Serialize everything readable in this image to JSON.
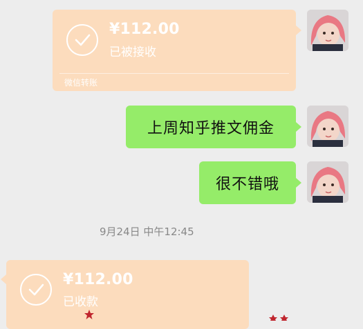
{
  "chat": {
    "messages": [
      {
        "type": "transfer",
        "amount": "¥112.00",
        "status": "已被接收",
        "footer": "微信转账"
      },
      {
        "type": "text",
        "text": "上周知乎推文佣金"
      },
      {
        "type": "text",
        "text": "很不错哦"
      }
    ],
    "timestamp": "9月24日 中午12:45",
    "incoming_transfer": {
      "amount": "¥112.00",
      "status": "已收款"
    }
  },
  "icons": [
    "check-circle-icon",
    "avatar-photo",
    "star-sticker"
  ],
  "colors": {
    "background": "#ededed",
    "transfer_card": "#fcdcbd",
    "green_bubble": "#95ec69",
    "sticker": "#c0262e"
  }
}
